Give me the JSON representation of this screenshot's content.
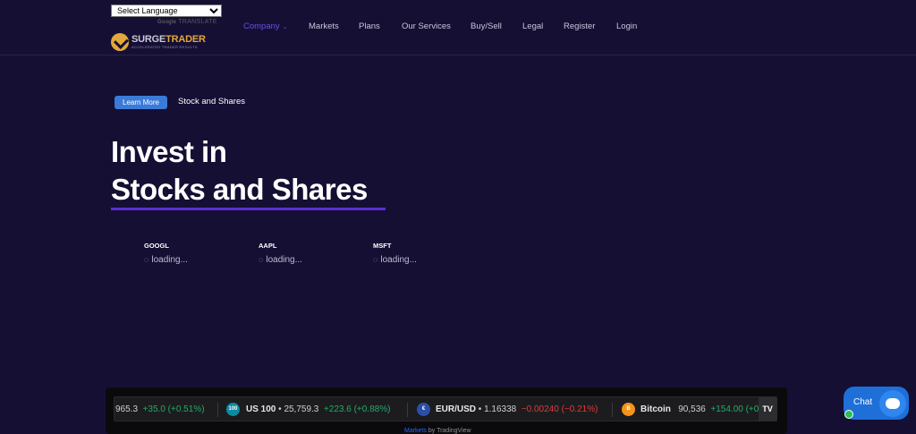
{
  "header": {
    "language_select": "Select Language",
    "google_translate": {
      "google": "Google",
      "translate": "TRANSLATE"
    },
    "logo": {
      "name_part1": "SURGE",
      "name_part2": "TRADER",
      "tagline": "ACCELERATED TRADER RESULTS"
    },
    "nav": [
      {
        "label": "Company",
        "active": true,
        "has_dropdown": true
      },
      {
        "label": "Markets"
      },
      {
        "label": "Plans"
      },
      {
        "label": "Our Services"
      },
      {
        "label": "Buy/Sell"
      },
      {
        "label": "Legal"
      },
      {
        "label": "Register"
      },
      {
        "label": "Login"
      }
    ]
  },
  "hero": {
    "badge": "Learn More",
    "badge_text": "Stock and Shares",
    "title_line1": "Invest in",
    "title_line2": "Stocks and Shares",
    "accent_color": "#5a2fd6"
  },
  "stocks": [
    {
      "symbol": "GOOGL",
      "status": "loading..."
    },
    {
      "symbol": "AAPL",
      "status": "loading..."
    },
    {
      "symbol": "MSFT",
      "status": "loading..."
    }
  ],
  "ticker": {
    "items": [
      {
        "name": "",
        "price": "965.3",
        "change": "+35.0 (+0.51%)",
        "direction": "up"
      },
      {
        "icon": "100",
        "name": "US 100",
        "price": "25,759.3",
        "change": "+223.6 (+0.88%)",
        "direction": "up"
      },
      {
        "icon": "flag-eu-us",
        "name": "EUR/USD",
        "price": "1.16338",
        "change": "−0.00240 (−0.21%)",
        "direction": "down"
      },
      {
        "icon": "B",
        "name": "Bitcoin",
        "price": "90,536",
        "change": "+154.00 (+0.",
        "direction": "up"
      }
    ],
    "tv_logo": "TV",
    "attribution": {
      "link": "Markets",
      "text": " by TradingView"
    }
  },
  "chat": {
    "label": "Chat"
  },
  "colors": {
    "background": "#150f34",
    "nav_active": "#6c4ce8",
    "badge": "#3b7bd8",
    "up": "#22ab6b",
    "down": "#e03a3a",
    "chat": "#1e6fd8"
  }
}
